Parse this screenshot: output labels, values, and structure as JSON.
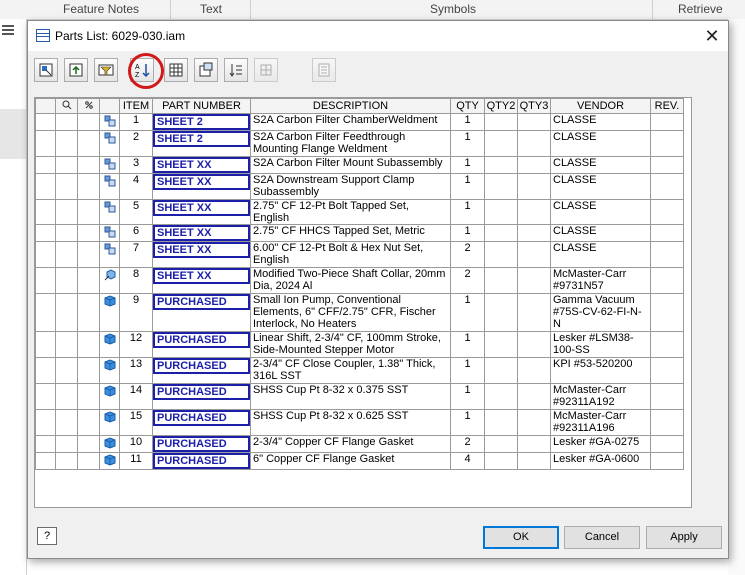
{
  "background": {
    "columns": [
      "Feature Notes",
      "Text",
      "Symbols",
      "Retrieve"
    ]
  },
  "dialog": {
    "title": "Parts List: 6029-030.iam",
    "close_glyph": "✕",
    "help_label": "?",
    "ok_label": "OK",
    "cancel_label": "Cancel",
    "apply_label": "Apply",
    "toolbar_icons": [
      "member-selection-icon",
      "export-icon",
      "filter-icon",
      "sort-icon",
      "column-chooser-icon",
      "group-settings-icon",
      "renumber-icon",
      "override-bom-icon",
      "table-wrapping-icon"
    ],
    "highlight_color": "#d11919"
  },
  "table": {
    "headers": [
      "",
      "",
      "",
      "",
      "ITEM",
      "PART NUMBER",
      "DESCRIPTION",
      "QTY",
      "QTY2",
      "QTY3",
      "VENDOR",
      "REV."
    ],
    "header_icons": [
      "",
      "find-icon",
      "percent-icon",
      ""
    ],
    "rows": [
      {
        "icon": "assembly",
        "item": "1",
        "part": "SHEET 2",
        "desc": "S2A Carbon Filter ChamberWeldment",
        "qty": "1",
        "vendor": "CLASSE"
      },
      {
        "icon": "assembly",
        "item": "2",
        "part": "SHEET 2",
        "desc": "S2A Carbon Filter Feedthrough Mounting Flange Weldment",
        "qty": "1",
        "vendor": "CLASSE"
      },
      {
        "icon": "assembly",
        "item": "3",
        "part": "SHEET XX",
        "desc": "S2A Carbon Filter Mount Subassembly",
        "qty": "1",
        "vendor": "CLASSE"
      },
      {
        "icon": "assembly",
        "item": "4",
        "part": "SHEET XX",
        "desc": "S2A Downstream Support Clamp Subassembly",
        "qty": "1",
        "vendor": "CLASSE"
      },
      {
        "icon": "assembly",
        "item": "5",
        "part": "SHEET XX",
        "desc": "2.75\" CF 12-Pt Bolt Tapped Set, English",
        "qty": "1",
        "vendor": "CLASSE"
      },
      {
        "icon": "assembly",
        "item": "6",
        "part": "SHEET XX",
        "desc": "2.75\" CF HHCS Tapped Set, Metric",
        "qty": "1",
        "vendor": "CLASSE"
      },
      {
        "icon": "assembly",
        "item": "7",
        "part": "SHEET XX",
        "desc": "6.00\" CF 12-Pt Bolt & Hex Nut Set, English",
        "qty": "2",
        "vendor": "CLASSE"
      },
      {
        "icon": "part-derived",
        "item": "8",
        "part": "SHEET XX",
        "desc": "Modified Two-Piece Shaft Collar, 20mm Dia, 2024 Al",
        "qty": "2",
        "vendor": "McMaster-Carr #9731N57"
      },
      {
        "icon": "part",
        "item": "9",
        "part": "PURCHASED",
        "desc": "Small Ion Pump, Conventional Elements, 6\" CFF/2.75\" CFR, Fischer Interlock, No Heaters",
        "qty": "1",
        "vendor": "Gamma Vacuum #75S-CV-62-FI-N-N"
      },
      {
        "icon": "part",
        "item": "12",
        "part": "PURCHASED",
        "desc": "Linear Shift, 2-3/4\" CF, 100mm Stroke, Side-Mounted Stepper Motor",
        "qty": "1",
        "vendor": "Lesker #LSM38-100-SS"
      },
      {
        "icon": "part",
        "item": "13",
        "part": "PURCHASED",
        "desc": "2-3/4\" CF Close Coupler, 1.38\" Thick, 316L SST",
        "qty": "1",
        "vendor": "KPI #53-520200"
      },
      {
        "icon": "part",
        "item": "14",
        "part": "PURCHASED",
        "desc": "SHSS Cup Pt 8-32 x 0.375 SST",
        "qty": "1",
        "vendor": "McMaster-Carr #92311A192"
      },
      {
        "icon": "part",
        "item": "15",
        "part": "PURCHASED",
        "desc": "SHSS Cup Pt 8-32 x 0.625 SST",
        "qty": "1",
        "vendor": "McMaster-Carr #92311A196"
      },
      {
        "icon": "part",
        "item": "10",
        "part": "PURCHASED",
        "desc": "2-3/4\" Copper CF Flange Gasket",
        "qty": "2",
        "vendor": "Lesker #GA-0275"
      },
      {
        "icon": "part",
        "item": "11",
        "part": "PURCHASED",
        "desc": "6\" Copper CF Flange Gasket",
        "qty": "4",
        "vendor": "Lesker #GA-0600"
      }
    ]
  }
}
